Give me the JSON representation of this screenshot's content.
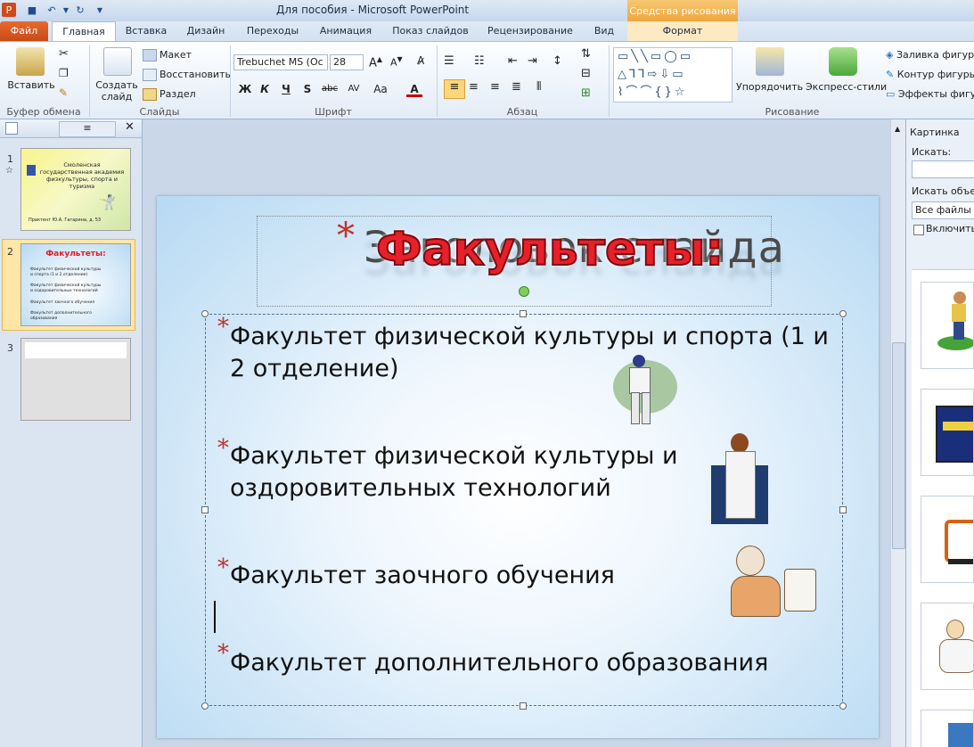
{
  "window": {
    "title": "Для пособия - Microsoft PowerPoint",
    "tools_header": "Средства рисования"
  },
  "tabs": [
    "Файл",
    "Главная",
    "Вставка",
    "Дизайн",
    "Переходы",
    "Анимация",
    "Показ слайдов",
    "Рецензирование",
    "Вид",
    "Формат"
  ],
  "ribbon": {
    "clipboard": {
      "paste": "Вставить",
      "label": "Буфер обмена"
    },
    "slides": {
      "new_slide": "Создать слайд",
      "layout": "Макет",
      "reset": "Восстановить",
      "section": "Раздел",
      "label": "Слайды"
    },
    "font": {
      "name": "Trebuchet MS (Ос",
      "size": "28",
      "label": "Шрифт",
      "bold": "Ж",
      "italic": "К",
      "underline": "Ч",
      "shadow": "S",
      "strike": "abc",
      "spacing": "AV",
      "case": "Aa"
    },
    "paragraph": {
      "label": "Абзац"
    },
    "drawing": {
      "arrange": "Упорядочить",
      "quick_styles": "Экспресс-стили",
      "fill": "Заливка фигуры",
      "outline": "Контур фигуры",
      "effects": "Эффекты фигур",
      "label": "Рисование"
    }
  },
  "thumbnails": [
    {
      "num": "1",
      "title": "Смоленская государственная академия физкультуры, спорта и туризма",
      "footer": "Практент Ю.А. Гагарина, д. 53"
    },
    {
      "num": "2",
      "title": "Факультеты:",
      "items": [
        "Факультет физической культуры и спорта (1 и 2 отделение)",
        "Факультет физической культуры и оздоровительных технологий",
        "Факультет заочного обучения",
        "Факультет дополнительного образования"
      ]
    },
    {
      "num": "3"
    }
  ],
  "slide": {
    "title_shadow": "Заголовок слайда",
    "title": "Факультеты:",
    "bullets": [
      "Факультет физической культуры и спорта (1 и 2 отделение)",
      "Факультет физической культуры и оздоровительных технологий",
      "Факультет заочного обучения",
      "Факультет дополнительного образования"
    ]
  },
  "clipart_pane": {
    "title": "Картинка",
    "search_label": "Искать:",
    "search_value": "",
    "search_in_label": "Искать объект",
    "search_in_value": "Все файлы му",
    "include_label": "Включить"
  },
  "colors": {
    "accent": "#c0342b",
    "tools": "#f0a53a",
    "file_tab": "#d4551f"
  }
}
